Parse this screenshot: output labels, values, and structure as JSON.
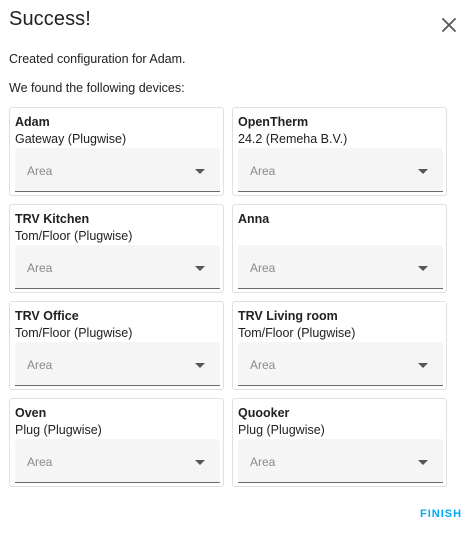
{
  "dialog": {
    "title": "Success!",
    "message": "Created configuration for Adam.",
    "devices_intro": "We found the following devices:",
    "finish_label": "FINISH"
  },
  "devices": [
    {
      "name": "Adam",
      "model": "Gateway (Plugwise)",
      "area_placeholder": "Area"
    },
    {
      "name": "OpenTherm",
      "model": "24.2 (Remeha B.V.)",
      "area_placeholder": "Area"
    },
    {
      "name": "TRV Kitchen",
      "model": "Tom/Floor (Plugwise)",
      "area_placeholder": "Area"
    },
    {
      "name": "Anna",
      "model": "",
      "area_placeholder": "Area"
    },
    {
      "name": "TRV Office",
      "model": "Tom/Floor (Plugwise)",
      "area_placeholder": "Area"
    },
    {
      "name": "TRV Living room",
      "model": "Tom/Floor (Plugwise)",
      "area_placeholder": "Area"
    },
    {
      "name": "Oven",
      "model": "Plug (Plugwise)",
      "area_placeholder": "Area"
    },
    {
      "name": "Quooker",
      "model": "Plug (Plugwise)",
      "area_placeholder": "Area"
    }
  ],
  "colors": {
    "accent": "#03a9f4",
    "text": "#212121",
    "field_bg": "#f5f5f5"
  },
  "icons": {
    "close": "close-icon",
    "dropdown": "chevron-down-icon"
  }
}
